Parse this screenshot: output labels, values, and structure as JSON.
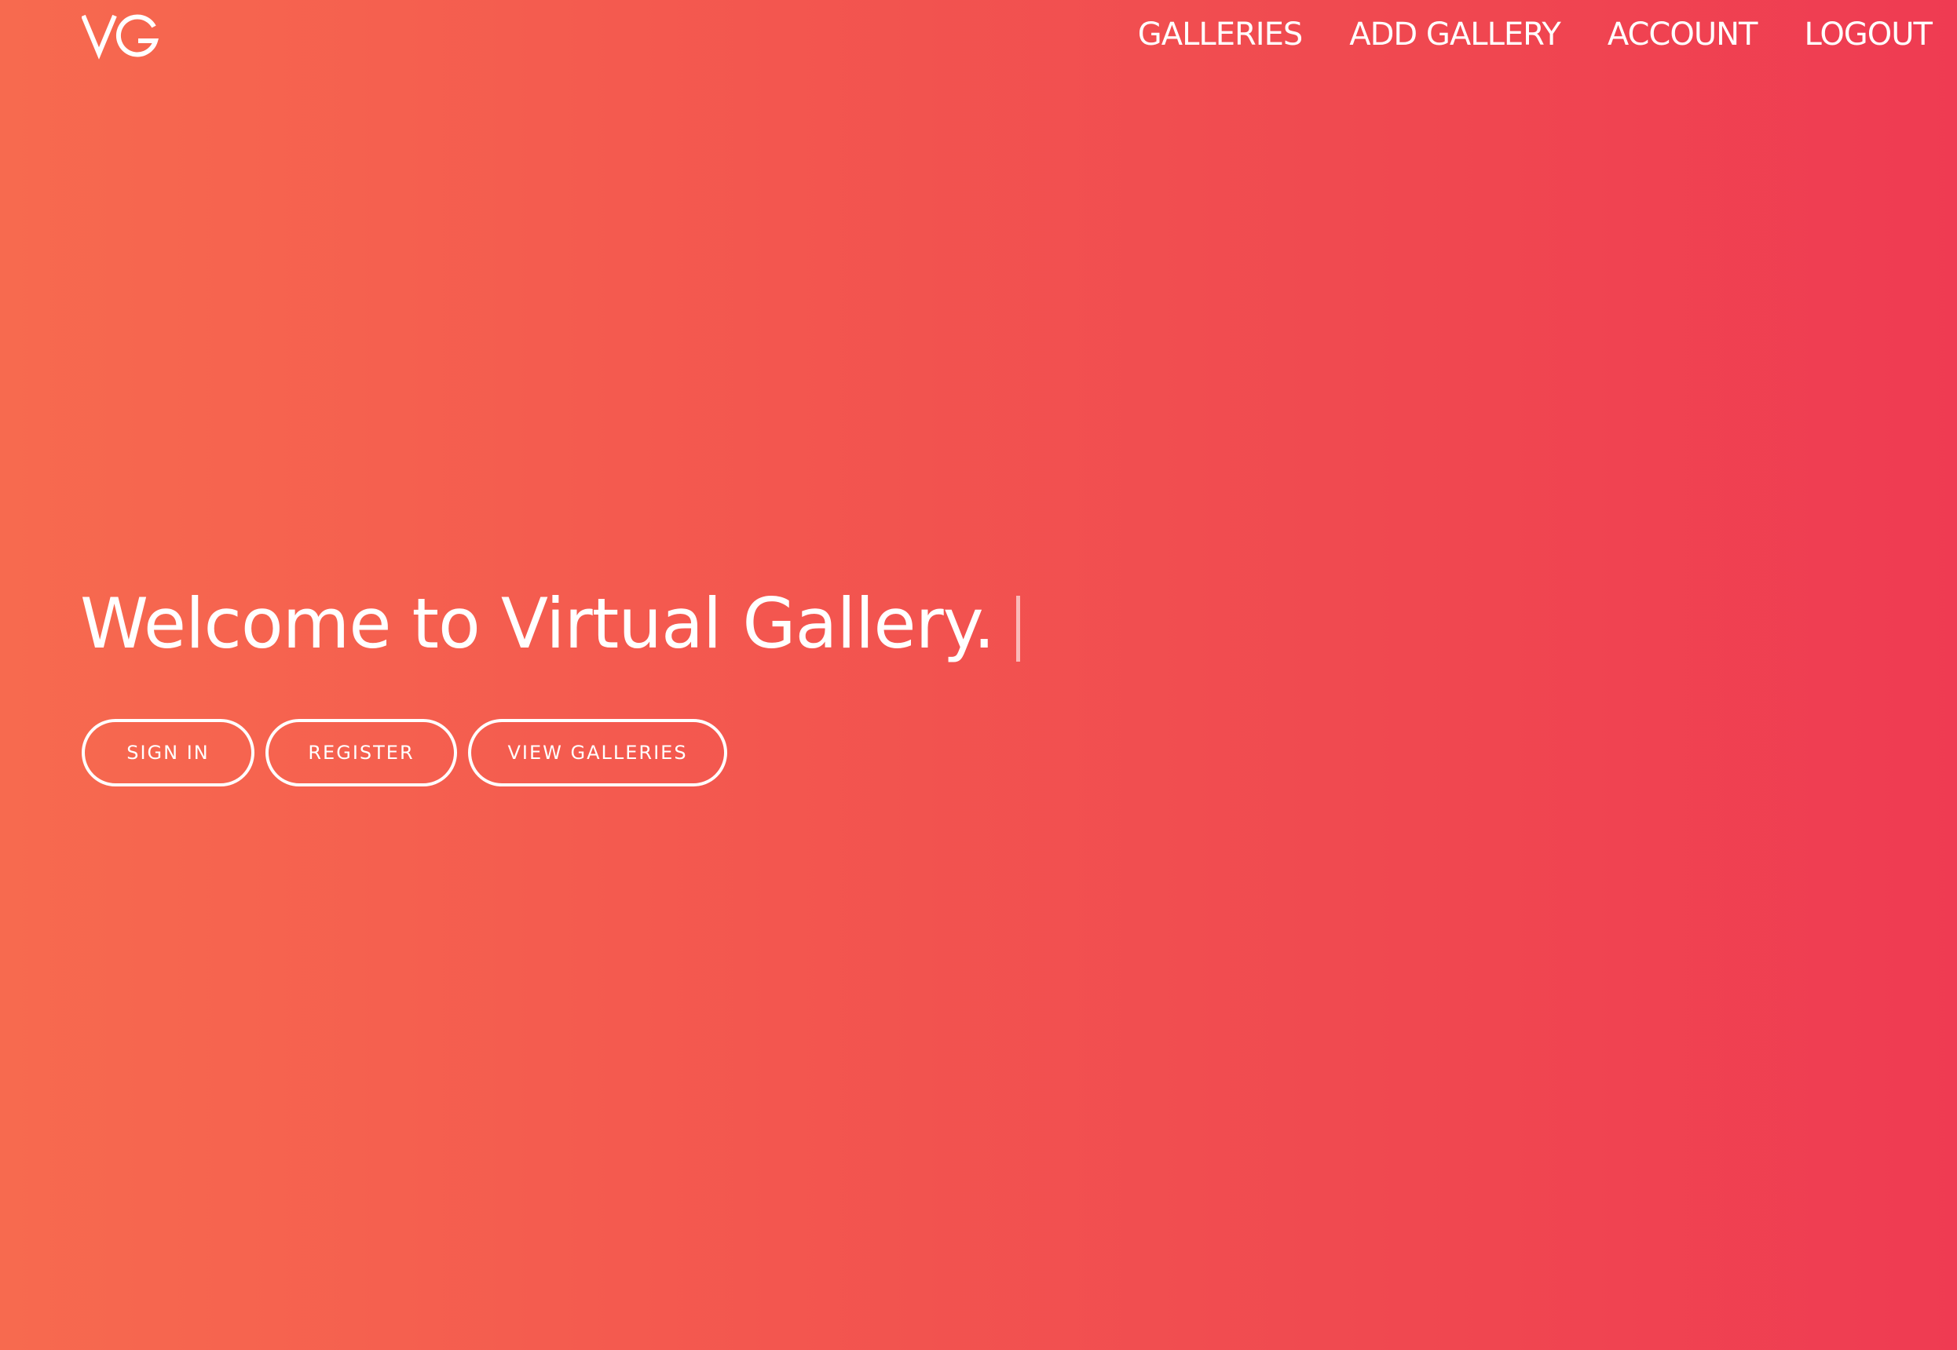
{
  "brand": {
    "logo_text": "VG",
    "gradient_start": "#f76a4f",
    "gradient_end": "#ef3b52"
  },
  "nav": {
    "items": [
      {
        "label": "GALLERIES"
      },
      {
        "label": "ADD GALLERY"
      },
      {
        "label": "ACCOUNT"
      },
      {
        "label": "LOGOUT"
      }
    ]
  },
  "hero": {
    "title": "Welcome to Virtual Gallery.",
    "buttons": {
      "sign_in": "SIGN IN",
      "register": "REGISTER",
      "view_galleries": "VIEW GALLERIES"
    }
  }
}
